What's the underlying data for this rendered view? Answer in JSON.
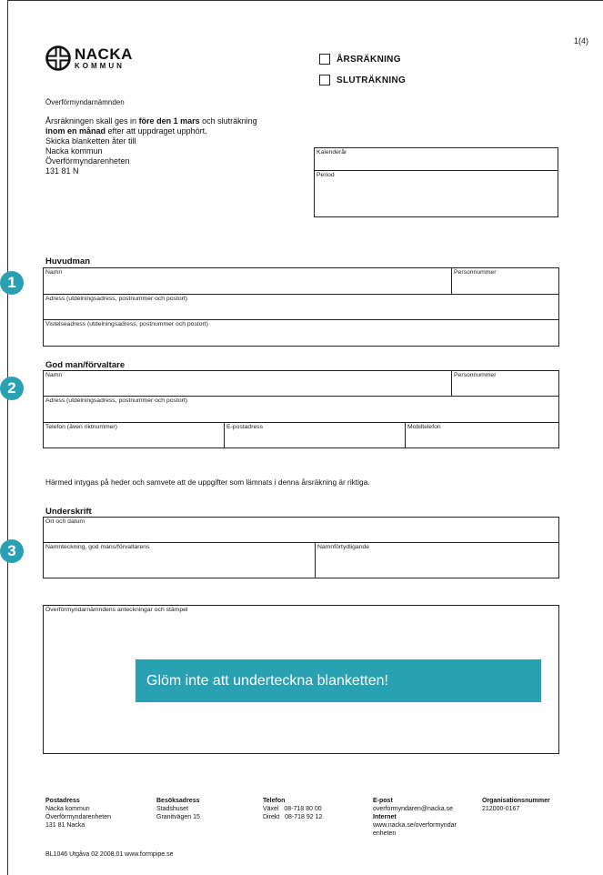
{
  "page": {
    "number": "1(4)"
  },
  "logo": {
    "name": "NACKA",
    "sub": "KOMMUN"
  },
  "form_type": {
    "option1": "ÅRSRÄKNING",
    "option2": "SLUTRÄKNING"
  },
  "org_name": "Överförmyndarnämnden",
  "instructions": {
    "part1": "Årsräkningen skall ges in ",
    "bold1": "före den 1 mars",
    "part2": " och sluträkning",
    "bold2": "inom en månad",
    "part3": " efter att uppdraget upphört.",
    "line3": "Skicka blanketten åter till",
    "line4": "Nacka kommun",
    "line5": "Överförmyndarenheten",
    "line6": "131 81 N"
  },
  "period_box": {
    "calendar_year": "Kalenderår",
    "period": "Period"
  },
  "markers": [
    "1",
    "2",
    "3"
  ],
  "huvudman": {
    "title": "Huvudman",
    "name": "Namn",
    "personnummer": "Personnummer",
    "address": "Adress (utdelningsadress, postnummer och postort)",
    "visitor_address": "Vistelseadress (utdelningsadress, postnummer och postort)"
  },
  "godman": {
    "title": "God man/förvaltare",
    "name": "Namn",
    "personnummer": "Personnummer",
    "address": "Adress (utdelningsadress, postnummer och postort)",
    "phone": "Telefon (även riktnummer)",
    "email": "E-postadress",
    "mobile": "Mobiltelefon"
  },
  "certification": "Härmed intygas på heder och samvete att de uppgifter som lämnats i denna årsräkning är riktiga.",
  "signature": {
    "title": "Underskrift",
    "place_date": "Ort och datum",
    "signature": "Namnteckning, god mans/förvaltarens",
    "clarification": "Namnförtydligande"
  },
  "notes": {
    "label": "Överförmyndarnämndens anteckningar och stämpel"
  },
  "banner": "Glöm inte att underteckna blanketten!",
  "footer": {
    "postal": {
      "title": "Postadress",
      "l1": "Nacka kommun",
      "l2": "Överförmyndarenheten",
      "l3": "131 81 Nacka"
    },
    "visit": {
      "title": "Besöksadress",
      "l1": "Stadshuset",
      "l2": "Granitvägen 15"
    },
    "phone": {
      "title": "Telefon",
      "l1": "Växel   08-718 80 00",
      "l2": "Direkt   08-718 92 12"
    },
    "email": {
      "title": "E-post",
      "l1": "overformyndaren@nacka.se",
      "internet_title": "Internet",
      "l2": "www.nacka.se/overformyndar",
      "l3": "enheten"
    },
    "org": {
      "title": "Organisationsnummer",
      "l1": "212000-0167"
    },
    "form_id": "BL1046  Utgåva 02  2008.01  www.formpipe.se"
  },
  "colors": {
    "accent": "#2aa1b3"
  }
}
